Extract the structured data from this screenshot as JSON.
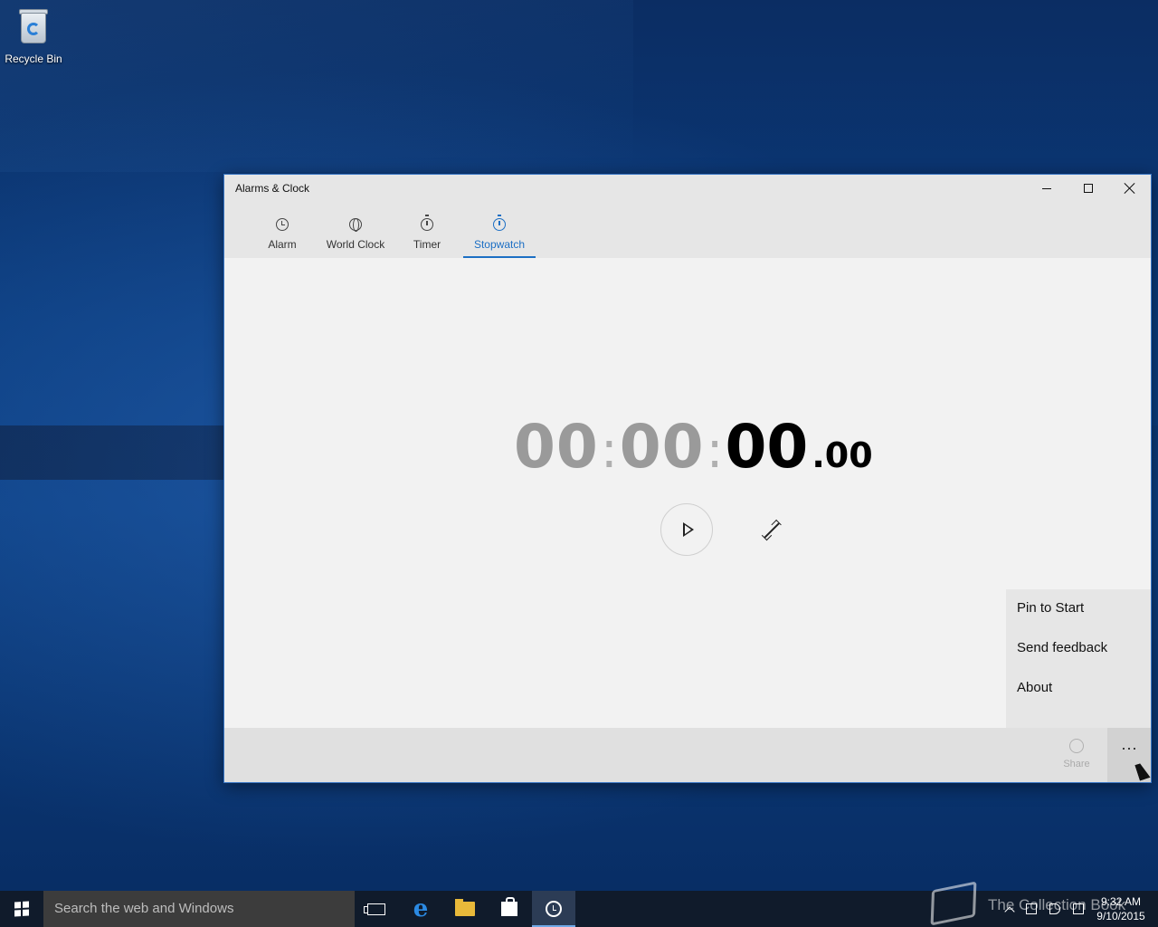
{
  "desktop": {
    "icons": [
      {
        "label": "Recycle Bin",
        "icon": "recycle-bin-icon"
      }
    ]
  },
  "window": {
    "title": "Alarms & Clock",
    "controls": {
      "minimize": "minimize-icon",
      "maximize": "maximize-icon",
      "close": "close-icon"
    }
  },
  "tabs": [
    {
      "label": "Alarm",
      "icon": "alarm-icon",
      "active": false
    },
    {
      "label": "World Clock",
      "icon": "world-clock-icon",
      "active": false
    },
    {
      "label": "Timer",
      "icon": "timer-icon",
      "active": false
    },
    {
      "label": "Stopwatch",
      "icon": "stopwatch-icon",
      "active": true
    }
  ],
  "stopwatch": {
    "hours": "00",
    "minutes": "00",
    "seconds": "00",
    "fraction": ".00",
    "separator": ":",
    "play_icon": "play-icon",
    "expand_icon": "expand-icon"
  },
  "overflow_menu": {
    "items": [
      "Pin to Start",
      "Send feedback",
      "About"
    ]
  },
  "app_bar": {
    "share_label": "Share",
    "share_icon": "share-icon",
    "more_label": "···"
  },
  "taskbar": {
    "search_placeholder": "Search the web and Windows",
    "watermark": "The Collection Book",
    "time": "9:32 AM",
    "date": "9/10/2015",
    "accent": "#6fa8e6"
  },
  "colors": {
    "accent": "#1c6fc4",
    "window_border": "#3a77c5"
  }
}
